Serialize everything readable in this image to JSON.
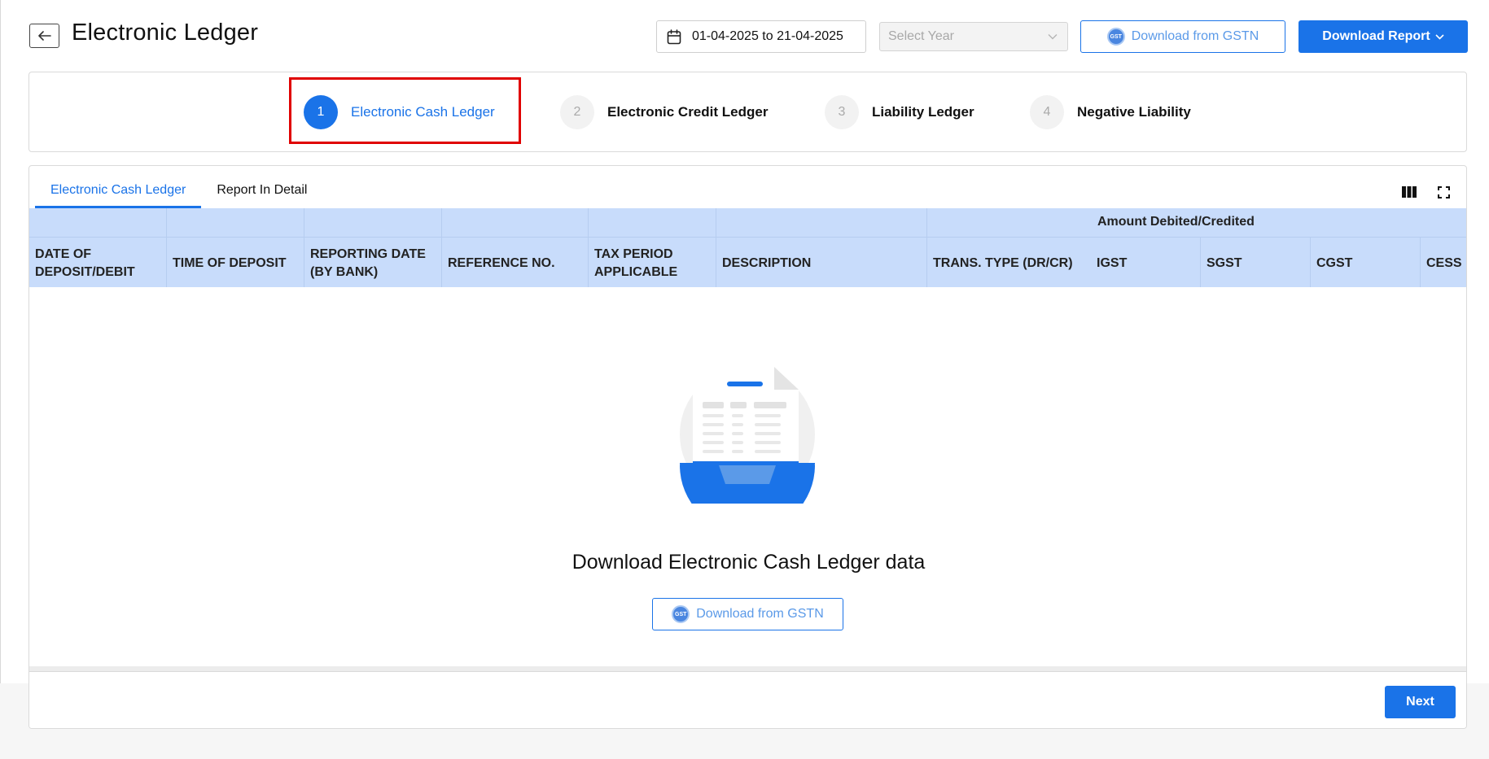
{
  "header": {
    "title": "Electronic Ledger",
    "date_range": "01-04-2025 to 21-04-2025",
    "year_placeholder": "Select Year",
    "download_gstn_label": "Download from GSTN",
    "download_report_label": "Download Report"
  },
  "stepper": {
    "steps": [
      {
        "number": "1",
        "label": "Electronic Cash Ledger",
        "active": true
      },
      {
        "number": "2",
        "label": "Electronic Credit Ledger",
        "active": false
      },
      {
        "number": "3",
        "label": "Liability Ledger",
        "active": false
      },
      {
        "number": "4",
        "label": "Negative Liability",
        "active": false
      }
    ]
  },
  "tabs": [
    {
      "label": "Electronic Cash Ledger",
      "active": true
    },
    {
      "label": "Report In Detail",
      "active": false
    }
  ],
  "table": {
    "group_header": "Amount Debited/Credited",
    "columns": [
      "DATE OF DEPOSIT/DEBIT",
      "TIME OF DEPOSIT",
      "REPORTING DATE (BY BANK)",
      "REFERENCE NO.",
      "TAX PERIOD APPLICABLE",
      "DESCRIPTION",
      "TRANS. TYPE (DR/CR)",
      "IGST",
      "SGST",
      "CGST",
      "CESS"
    ]
  },
  "empty_state": {
    "title": "Download Electronic Cash Ledger data",
    "button_label": "Download from GSTN"
  },
  "footer": {
    "next_label": "Next"
  },
  "colors": {
    "primary": "#1a73e8",
    "header_bg": "#c8dcfb",
    "highlight": "#e00000"
  }
}
